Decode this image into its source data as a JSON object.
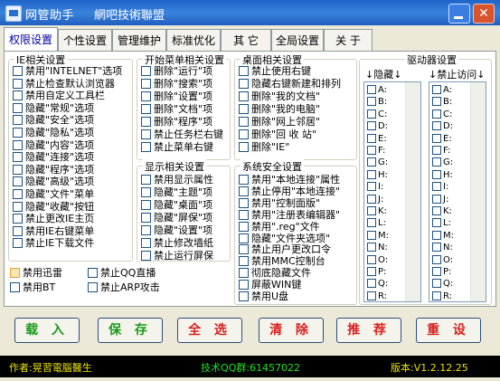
{
  "window": {
    "title": "网管助手",
    "subtitle": "網吧技術聯盟",
    "close_label": "✕"
  },
  "tabs": [
    "权限设置",
    "个性设置",
    "管理维护",
    "标准优化",
    "其 它",
    "全局设置",
    "关 于"
  ],
  "ie": {
    "title": "IE相关设置",
    "items": [
      "禁用\"INTELNET\"选项",
      "禁止检查默认浏览器",
      "禁用自定义工具栏",
      "隐藏\"常规\"选项",
      "隐藏\"安全\"选项",
      "隐藏\"隐私\"选项",
      "隐藏\"内容\"选项",
      "隐藏\"连接\"选项",
      "隐藏\"程序\"选项",
      "隐藏\"高级\"选项",
      "隐藏\"文件\"菜单",
      "隐藏\"收藏\"按钮",
      "禁止更改IE主页",
      "禁用IE右键菜单",
      "禁止IE下载文件"
    ]
  },
  "extra": [
    "禁用迅雷",
    "禁止QQ直播",
    "禁用BT",
    "禁止ARP攻击"
  ],
  "start_menu": {
    "title": "开始菜单相关设置",
    "items": [
      "删除\"运行\"项",
      "删除\"搜索\"项",
      "删除\"设置\"项",
      "删除\"文档\"项",
      "删除\"程序\"项",
      "禁止任务栏右键",
      "禁止菜单右键"
    ]
  },
  "display": {
    "title": "显示相关设置",
    "items": [
      "禁用显示属性",
      "隐藏\"主题\"项",
      "隐藏\"桌面\"项",
      "隐藏\"屏保\"项",
      "隐藏\"设置\"项",
      "禁止修改墙纸",
      "禁止运行屏保"
    ]
  },
  "desktop": {
    "title": "桌面相关设置",
    "items": [
      "禁止使用右键",
      "隐藏右键新建和排列",
      "删除\"我的文档\"",
      "删除\"我的电脑\"",
      "删除\"网上邻居\"",
      "删除\"回 收 站\"",
      "删除\"IE\""
    ]
  },
  "system": {
    "title": "系统安全设置",
    "items": [
      "禁用\"本地连接\"属性",
      "禁止停用\"本地连接\"",
      "禁用\"控制面版\"",
      "禁用\"注册表编辑器\"",
      "禁用\".reg\"文件",
      "隐藏\"文件夹选项\"",
      "禁止用户更改口令",
      "禁用MMC控制台",
      "彻底隐藏文件",
      "屏蔽WIN键",
      "禁用U盘"
    ]
  },
  "drives": {
    "title": "驱动器设置",
    "hide_label": "↓隐藏↓",
    "block_label": "↓禁止访问↓",
    "letters": [
      "A:",
      "B:",
      "C:",
      "D:",
      "E:",
      "F:",
      "G:",
      "H:",
      "I:",
      "J:",
      "K:",
      "L:",
      "M:",
      "N:",
      "O:",
      "P:",
      "Q:",
      "R:"
    ]
  },
  "buttons": [
    "载 入",
    "保 存",
    "全 选",
    "清 除",
    "推 荐",
    "重 设"
  ],
  "status": {
    "author": "作者:晃習電腦醫生",
    "qq": "技术QQ群:61457022",
    "version": "版本:V1.2.12.25"
  }
}
